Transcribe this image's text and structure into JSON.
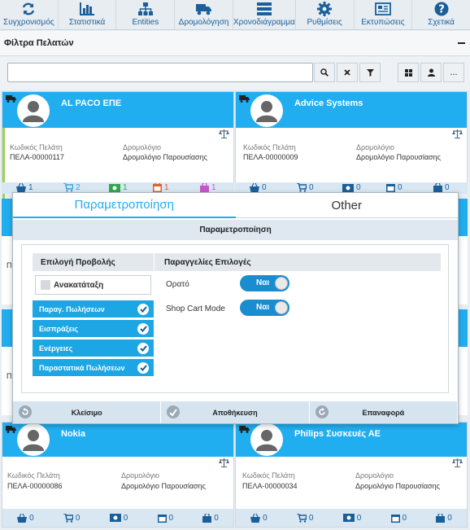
{
  "nav": {
    "items": [
      {
        "label": "Συγχρονισμός",
        "icon": "sync-icon"
      },
      {
        "label": "Στατιστικά",
        "icon": "bar-chart-icon"
      },
      {
        "label": "Entities",
        "icon": "sitemap-icon"
      },
      {
        "label": "Δρομολόγηση",
        "icon": "truck-icon"
      },
      {
        "label": "Χρονοδιάγραμμα",
        "icon": "timeline-icon"
      },
      {
        "label": "Ρυθμίσεις",
        "icon": "gear-icon"
      },
      {
        "label": "Εκτυπώσεις",
        "icon": "newspaper-icon"
      },
      {
        "label": "Σχετικά",
        "icon": "question-icon"
      }
    ]
  },
  "filter": {
    "title": "Φίλτρα Πελατών",
    "search_value": "",
    "extra_button": "..."
  },
  "cards": [
    {
      "name": "AL PACO ΕΠΕ",
      "code_label": "Κωδικός Πελάτη",
      "code": "ΠΕΛΑ-00000117",
      "route_label": "Δρομολόγιο",
      "route": "Δρομολόγιο Παρουσίασης",
      "counts": [
        "1",
        "2",
        "1",
        "1",
        "1"
      ]
    },
    {
      "name": "Advice Systems",
      "code_label": "Κωδικός Πελάτη",
      "code": "ΠΕΛΑ-00000009",
      "route_label": "Δρομολόγιο",
      "route": "Δρομολόγιο Παρουσίασης",
      "counts": [
        "0",
        "0",
        "0",
        "0",
        "0"
      ]
    },
    {
      "name": "Nokia",
      "code_label": "Κωδικός Πελάτη",
      "code": "ΠΕΛΑ-00000086",
      "route_label": "Δρομολόγιο",
      "route": "Δρομολόγιο Παρουσίασης",
      "counts": [
        "0",
        "0",
        "0",
        "0",
        "0"
      ]
    },
    {
      "name": "Philips Συσκευές ΑΕ",
      "code_label": "Κωδικός Πελάτη",
      "code": "ΠΕΛΑ-00000034",
      "route_label": "Δρομολόγιο",
      "route": "Δρομολόγιο Παρουσίασης",
      "counts": [
        "0",
        "0",
        "0",
        "0",
        "0"
      ]
    }
  ],
  "partial_cards": [
    {
      "code_prefix": "ΠΕ"
    },
    {
      "code_prefix": "ΠΕ"
    }
  ],
  "dialog": {
    "tabs": [
      "Παραμετροποίηση",
      "Other"
    ],
    "title": "Παραμετροποίηση",
    "view_header": "Επιλογή Προβολής",
    "orders_header": "Παραγγελίες Επιλογές",
    "reorder_label": "Ανακατάταξη",
    "options": [
      "Παραγ. Πωλήσεων",
      "Εισπράξεις",
      "Ενέργειες",
      "Παραστατικά Πωλήσεων"
    ],
    "properties": [
      {
        "label": "Ορατό",
        "value": "Ναι"
      },
      {
        "label": "Shop Cart Mode",
        "value": "Ναι"
      }
    ],
    "buttons": {
      "close": "Κλείσιμο",
      "save": "Αποθήκευση",
      "reset": "Επαναφορά"
    }
  },
  "colors": {
    "accent": "#21aef0",
    "nav_text": "#1a5f99",
    "footer": "#d9e7f3"
  }
}
